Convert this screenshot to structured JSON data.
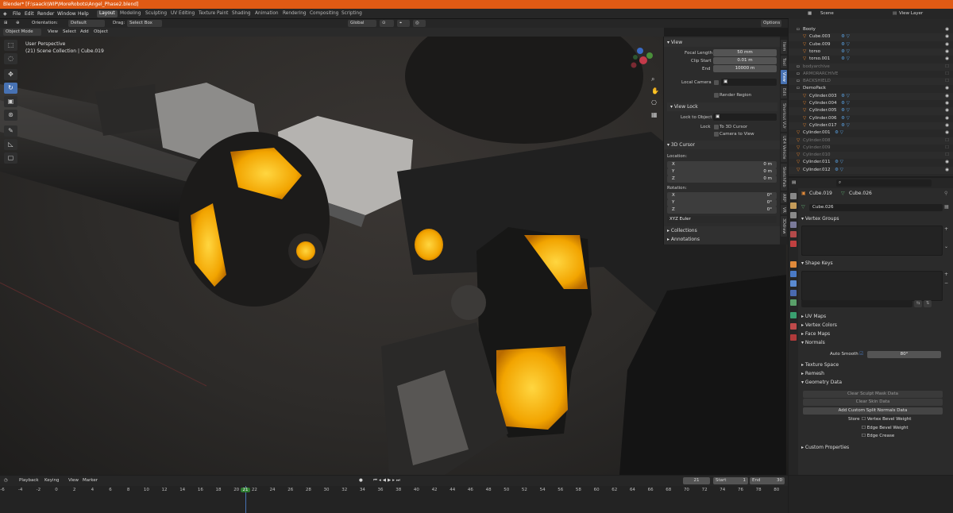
{
  "title_bar": "Blender* [F:\\saack\\WIP\\MoreRobots\\Angel_Phase2.blend]",
  "menu": [
    "File",
    "Edit",
    "Render",
    "Window",
    "Help"
  ],
  "workspaces": [
    "Layout",
    "Modeling",
    "Sculpting",
    "UV Editing",
    "Texture Paint",
    "Shading",
    "Animation",
    "Rendering",
    "Compositing",
    "Scripting"
  ],
  "active_workspace": "Layout",
  "scene": {
    "label": "Scene",
    "view_layer": "View Layer"
  },
  "viewport_header": {
    "orientation_label": "Orientation:",
    "orientation_value": "Default",
    "drag_label": "Drag:",
    "drag_value": "Select Box",
    "transform": "Global",
    "options": "Options"
  },
  "viewport_header2": {
    "mode": "Object Mode",
    "items": [
      "View",
      "Select",
      "Add",
      "Object"
    ]
  },
  "viewport_info": {
    "line1": "User Perspective",
    "line2": "(21) Scene Collection | Cube.019"
  },
  "npanel": {
    "view_header": "View",
    "focal_length_label": "Focal Length",
    "focal_length": "50 mm",
    "clip_start_label": "Clip Start",
    "clip_start": "0.01 m",
    "end_label": "End",
    "end": "10000 m",
    "local_camera_label": "Local Camera",
    "render_region": "Render Region",
    "view_lock_header": "View Lock",
    "lock_to_object_label": "Lock to Object",
    "lock_label": "Lock",
    "to_3d_cursor": "To 3D Cursor",
    "camera_to_view": "Camera to View",
    "cursor_header": "3D Cursor",
    "location_label": "Location:",
    "loc": [
      {
        "axis": "X",
        "value": "0 m"
      },
      {
        "axis": "Y",
        "value": "0 m"
      },
      {
        "axis": "Z",
        "value": "0 m"
      }
    ],
    "rotation_label": "Rotation:",
    "rot": [
      {
        "axis": "X",
        "value": "0°"
      },
      {
        "axis": "Y",
        "value": "0°"
      },
      {
        "axis": "Z",
        "value": "0°"
      }
    ],
    "rotation_mode": "XYZ Euler",
    "collections": "Collections",
    "annotations": "Annotations"
  },
  "ntabs": [
    "Item",
    "Tool",
    "View",
    "Edit",
    "Shortcut VUr",
    "UE4 Vehicle",
    "SketchFab",
    "ARP",
    "VR",
    "3Ddraw"
  ],
  "active_ntab": "View",
  "outliner": [
    {
      "name": "Booty",
      "indent": 1,
      "dim": false,
      "orange": false
    },
    {
      "name": "Cube.003",
      "indent": 2,
      "dim": false,
      "orange": true
    },
    {
      "name": "Cube.009",
      "indent": 2,
      "dim": false,
      "orange": true
    },
    {
      "name": "torso",
      "indent": 2,
      "dim": false,
      "orange": true
    },
    {
      "name": "torso.001",
      "indent": 2,
      "dim": false,
      "orange": true
    },
    {
      "name": "bodyarchive",
      "indent": 1,
      "dim": true,
      "orange": false
    },
    {
      "name": "ARMORARCHIVE",
      "indent": 1,
      "dim": true,
      "orange": false
    },
    {
      "name": "BACKSHIELD",
      "indent": 1,
      "dim": true,
      "orange": false
    },
    {
      "name": "DemoPack",
      "indent": 1,
      "dim": false,
      "orange": false
    },
    {
      "name": "Cylinder.003",
      "indent": 2,
      "dim": false,
      "orange": true
    },
    {
      "name": "Cylinder.004",
      "indent": 2,
      "dim": false,
      "orange": true
    },
    {
      "name": "Cylinder.005",
      "indent": 2,
      "dim": false,
      "orange": true
    },
    {
      "name": "Cylinder.006",
      "indent": 2,
      "dim": false,
      "orange": true
    },
    {
      "name": "Cylinder.017",
      "indent": 2,
      "dim": false,
      "orange": true
    },
    {
      "name": "Cylinder.001",
      "indent": 1,
      "dim": false,
      "orange": true
    },
    {
      "name": "Cylinder.008",
      "indent": 1,
      "dim": true,
      "orange": true
    },
    {
      "name": "Cylinder.009",
      "indent": 1,
      "dim": true,
      "orange": true
    },
    {
      "name": "Cylinder.010",
      "indent": 1,
      "dim": true,
      "orange": true
    },
    {
      "name": "Cylinder.011",
      "indent": 1,
      "dim": false,
      "orange": true
    },
    {
      "name": "Cylinder.012",
      "indent": 1,
      "dim": false,
      "orange": true
    }
  ],
  "props": {
    "object": "Cube.019",
    "mesh": "Cube.026",
    "mesh_field": "Cube.026",
    "vertex_groups": "Vertex Groups",
    "shape_keys": "Shape Keys",
    "uv_maps": "UV Maps",
    "vertex_colors": "Vertex Colors",
    "face_maps": "Face Maps",
    "normals": "Normals",
    "auto_smooth_label": "Auto Smooth",
    "auto_smooth_value": "80°",
    "texture_space": "Texture Space",
    "remesh": "Remesh",
    "geometry_data": "Geometry Data",
    "clear_sculpt": "Clear Sculpt Mask Data",
    "clear_skin": "Clear Skin Data",
    "add_custom_split": "Add Custom Split Normals Data",
    "store_label": "Store",
    "vertex_bevel": "Vertex Bevel Weight",
    "edge_bevel": "Edge Bevel Weight",
    "edge_crease": "Edge Crease",
    "custom_properties": "Custom Properties"
  },
  "timeline": {
    "items": [
      "Playback",
      "Keying",
      "View",
      "Marker"
    ],
    "current_frame": "21",
    "start_label": "Start",
    "start": "1",
    "end_label": "End",
    "end": "30",
    "ticks": [
      "-6",
      "-4",
      "-2",
      "0",
      "2",
      "4",
      "6",
      "8",
      "10",
      "12",
      "14",
      "16",
      "18",
      "20",
      "21",
      "22",
      "24",
      "26",
      "28",
      "30",
      "32",
      "34",
      "36",
      "38",
      "40",
      "42",
      "44",
      "46",
      "48",
      "50",
      "52",
      "54",
      "56",
      "58",
      "60",
      "62",
      "64",
      "66",
      "68",
      "70",
      "72",
      "74",
      "76",
      "78",
      "80"
    ]
  },
  "colors": {
    "accent": "#4772b3",
    "title": "#e05a14",
    "glow": "#ffb000",
    "orange_icon": "#e8832a"
  }
}
